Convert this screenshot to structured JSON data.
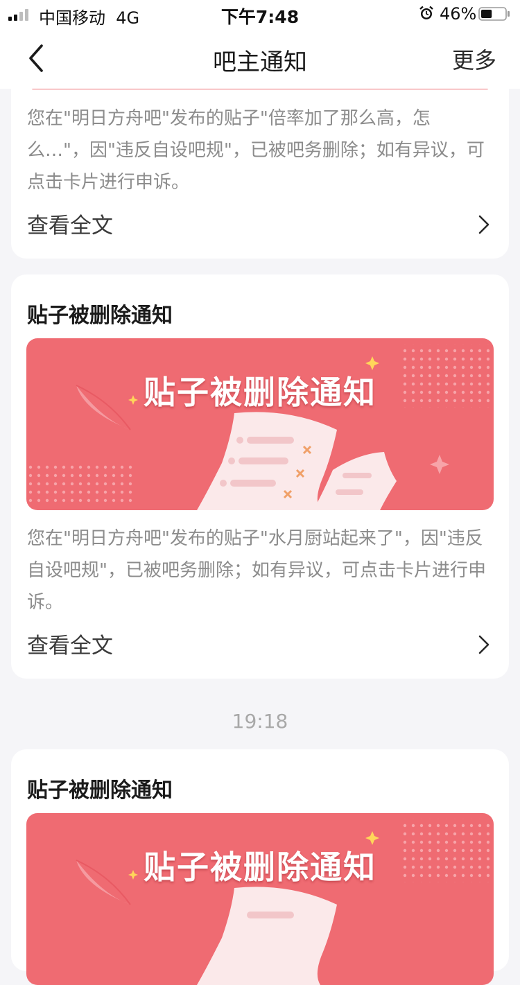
{
  "status_bar": {
    "carrier": "中国移动",
    "network": "4G",
    "time": "下午7:48",
    "battery_percent": "46%",
    "battery_level": 0.46
  },
  "nav": {
    "title": "吧主通知",
    "more_label": "更多"
  },
  "cards": [
    {
      "description": "您在\"明日方舟吧\"发布的贴子\"倍率加了那么高，怎么…\"，因\"违反自设吧规\"，已被吧务删除；如有异议，可点击卡片进行申诉。",
      "view_label": "查看全文"
    },
    {
      "title": "贴子被删除通知",
      "banner_text": "贴子被删除通知",
      "description": "您在\"明日方舟吧\"发布的贴子\"水月厨站起来了\"，因\"违反自设吧规\"，已被吧务删除；如有异议，可点击卡片进行申诉。",
      "view_label": "查看全文"
    },
    {
      "title": "贴子被删除通知",
      "banner_text": "贴子被删除通知"
    }
  ],
  "time_separator": "19:18",
  "colors": {
    "banner_red": "#ef6b72",
    "background": "#f5f5f8",
    "muted_text": "#8c8c8c"
  },
  "icons": [
    "signal-icon",
    "alarm-icon",
    "battery-icon",
    "back-arrow-icon",
    "chevron-right-icon"
  ]
}
